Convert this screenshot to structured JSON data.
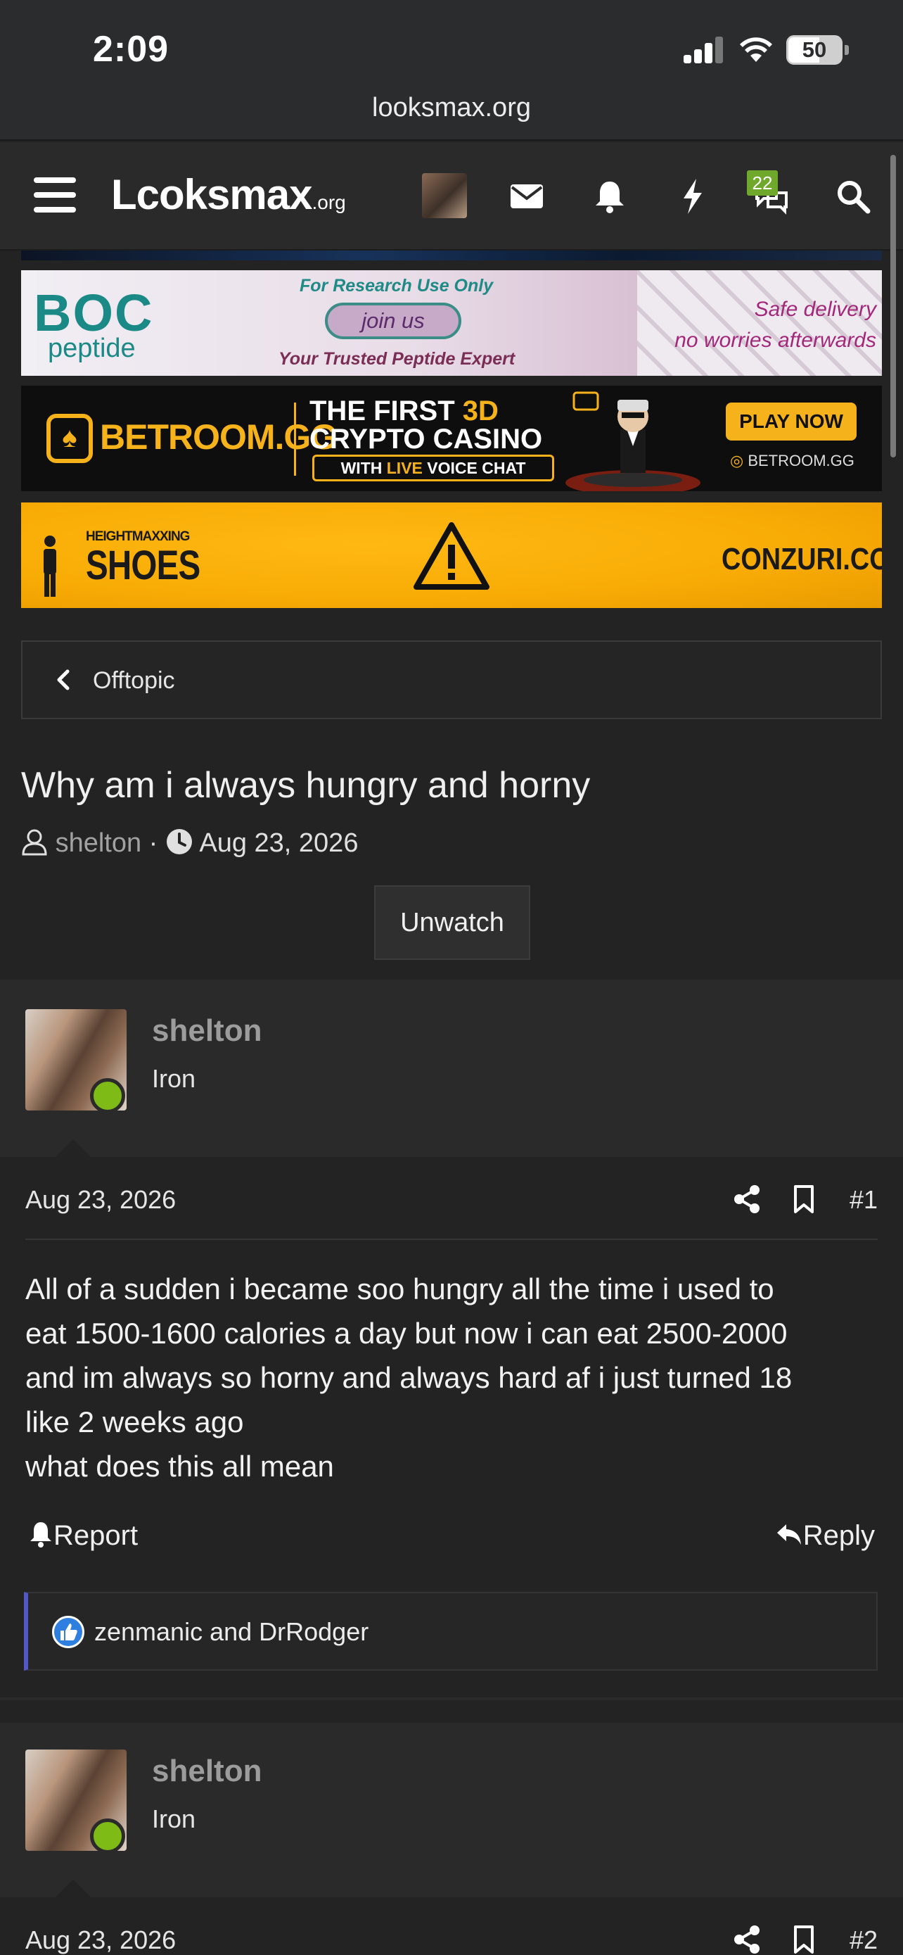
{
  "status_bar": {
    "time": "2:09",
    "battery": "50"
  },
  "browser": {
    "url": "looksmax.org"
  },
  "nav": {
    "logo": "Lcoksmax",
    "logo_suffix": ".org",
    "conversations_badge": "22"
  },
  "ads": {
    "boc": {
      "logo": "BOC",
      "sub": "peptide",
      "research": "For Research Use Only",
      "join": "join us",
      "tagline": "Your Trusted Peptide Expert",
      "safe1": "Safe delivery",
      "safe2": "no worries afterwards"
    },
    "betroom": {
      "logo": "BETROOM.GG",
      "headline1": "THE FIRST ",
      "headline_accent": "3D",
      "headline2": "CRYPTO CASINO",
      "live_pre": "WITH ",
      "live_accent": "LIVE",
      "live_post": " VOICE CHAT",
      "cta": "PLAY NOW",
      "site": "BETROOM.GG"
    },
    "conzuri": {
      "line1": "HEIGHTMAXXING",
      "line2": "SHOES",
      "site": "CONZURI.COM"
    }
  },
  "breadcrumb": {
    "label": "Offtopic"
  },
  "thread": {
    "title": "Why am i always hungry and horny",
    "author": "shelton",
    "separator": " · ",
    "date": "Aug 23, 2026",
    "unwatch": "Unwatch"
  },
  "posts": [
    {
      "username": "shelton",
      "rank": "Iron",
      "date": "Aug 23, 2026",
      "number": "#1",
      "body": [
        "All of a sudden i became soo hungry all the time i used to",
        "eat 1500-1600 calories a day but now i can eat 2500-2000",
        "and im always so horny and always hard af i just turned 18",
        "like 2 weeks ago",
        "what does this all mean"
      ],
      "report": "Report",
      "reply": "Reply",
      "reactions": "zenmanic and DrRodger"
    },
    {
      "username": "shelton",
      "rank": "Iron",
      "date": "Aug 23, 2026",
      "number": "#2"
    }
  ],
  "colors": {
    "background": "#232323",
    "panel": "#2a2a2a",
    "online": "#7fbb16",
    "badge": "#6fa82a",
    "reaction_accent": "#5457c6",
    "like": "#2f7fe0"
  }
}
